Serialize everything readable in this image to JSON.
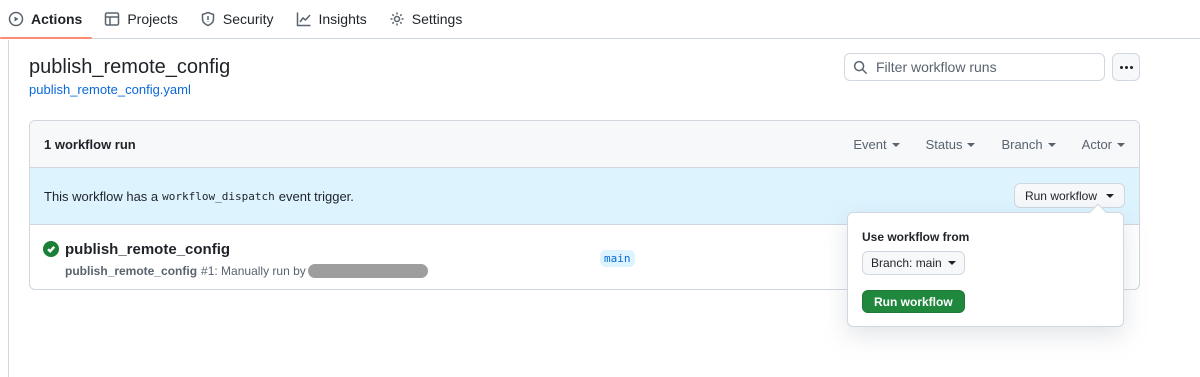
{
  "nav": {
    "tabs": [
      {
        "label": "Actions",
        "icon": "play-icon",
        "active": true
      },
      {
        "label": "Projects",
        "icon": "table-icon"
      },
      {
        "label": "Security",
        "icon": "shield-icon"
      },
      {
        "label": "Insights",
        "icon": "graph-icon"
      },
      {
        "label": "Settings",
        "icon": "gear-icon"
      }
    ]
  },
  "workflow": {
    "title": "publish_remote_config",
    "file_link": "publish_remote_config.yaml"
  },
  "search": {
    "placeholder": "Filter workflow runs"
  },
  "runs": {
    "count_label": "1 workflow run",
    "filters": [
      "Event",
      "Status",
      "Branch",
      "Actor"
    ],
    "dispatch": {
      "text_before": "This workflow has a",
      "code": "workflow_dispatch",
      "text_after": "event trigger.",
      "button_label": "Run workflow"
    },
    "items": [
      {
        "title": "publish_remote_config",
        "workflow_name": "publish_remote_config",
        "meta": "#1: Manually run by",
        "branch": "main",
        "status": "success"
      }
    ]
  },
  "popover": {
    "label": "Use workflow from",
    "branch_button": "Branch: main",
    "run_button": "Run workflow"
  },
  "colors": {
    "accent_underline": "#fd8c73",
    "link": "#0969da",
    "success": "#1a7f37",
    "primary_button": "#1f883d",
    "info_banner": "#ddf4ff"
  }
}
